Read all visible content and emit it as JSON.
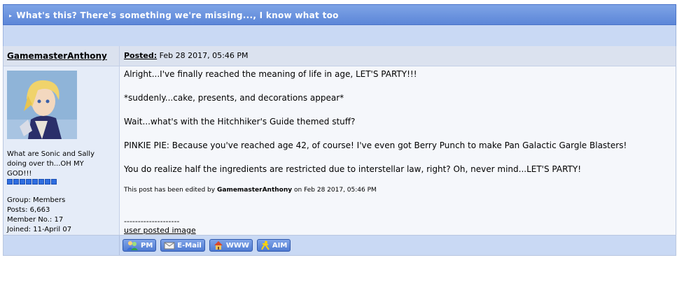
{
  "topic": {
    "title": "What's this? There's something we're missing..., I know what too"
  },
  "post": {
    "author": "GamemasterAnthony",
    "posted_label": "Posted:",
    "posted_date": "Feb 28 2017, 05:46 PM",
    "user_title_lines": [
      "What are Sonic and Sally",
      "doing over th...OH MY",
      "GOD!!!"
    ],
    "rank_pips": 8,
    "stats": [
      "Group: Members",
      "Posts: 6,663",
      "Member No.: 17",
      "Joined: 11-April 07"
    ],
    "paragraphs": [
      "Alright...I've finally reached the meaning of life in age, LET'S PARTY!!!",
      "*suddenly...cake, presents, and decorations appear*",
      "Wait...what's with the Hitchhiker's Guide themed stuff?",
      "PINKIE PIE: Because you've reached age 42, of course! I've even got Berry Punch to make Pan Galactic Gargle Blasters!",
      "You do realize half the ingredients are restricted due to interstellar law, right? Oh, never mind...LET'S PARTY!"
    ],
    "edited_prefix": "This post has been edited by",
    "edited_by": "GamemasterAnthony",
    "edited_suffix": "on Feb 28 2017, 05:46 PM",
    "signature_divider": "--------------------",
    "signature_link": "user posted image"
  },
  "buttons": [
    {
      "label": "PM",
      "icon": "people-icon"
    },
    {
      "label": "E-Mail",
      "icon": "envelope-icon"
    },
    {
      "label": "WWW",
      "icon": "home-icon"
    },
    {
      "label": "AIM",
      "icon": "aim-runner-icon"
    }
  ],
  "colors": {
    "accent": "#5c86d8",
    "pip": "#2f6ee0"
  }
}
